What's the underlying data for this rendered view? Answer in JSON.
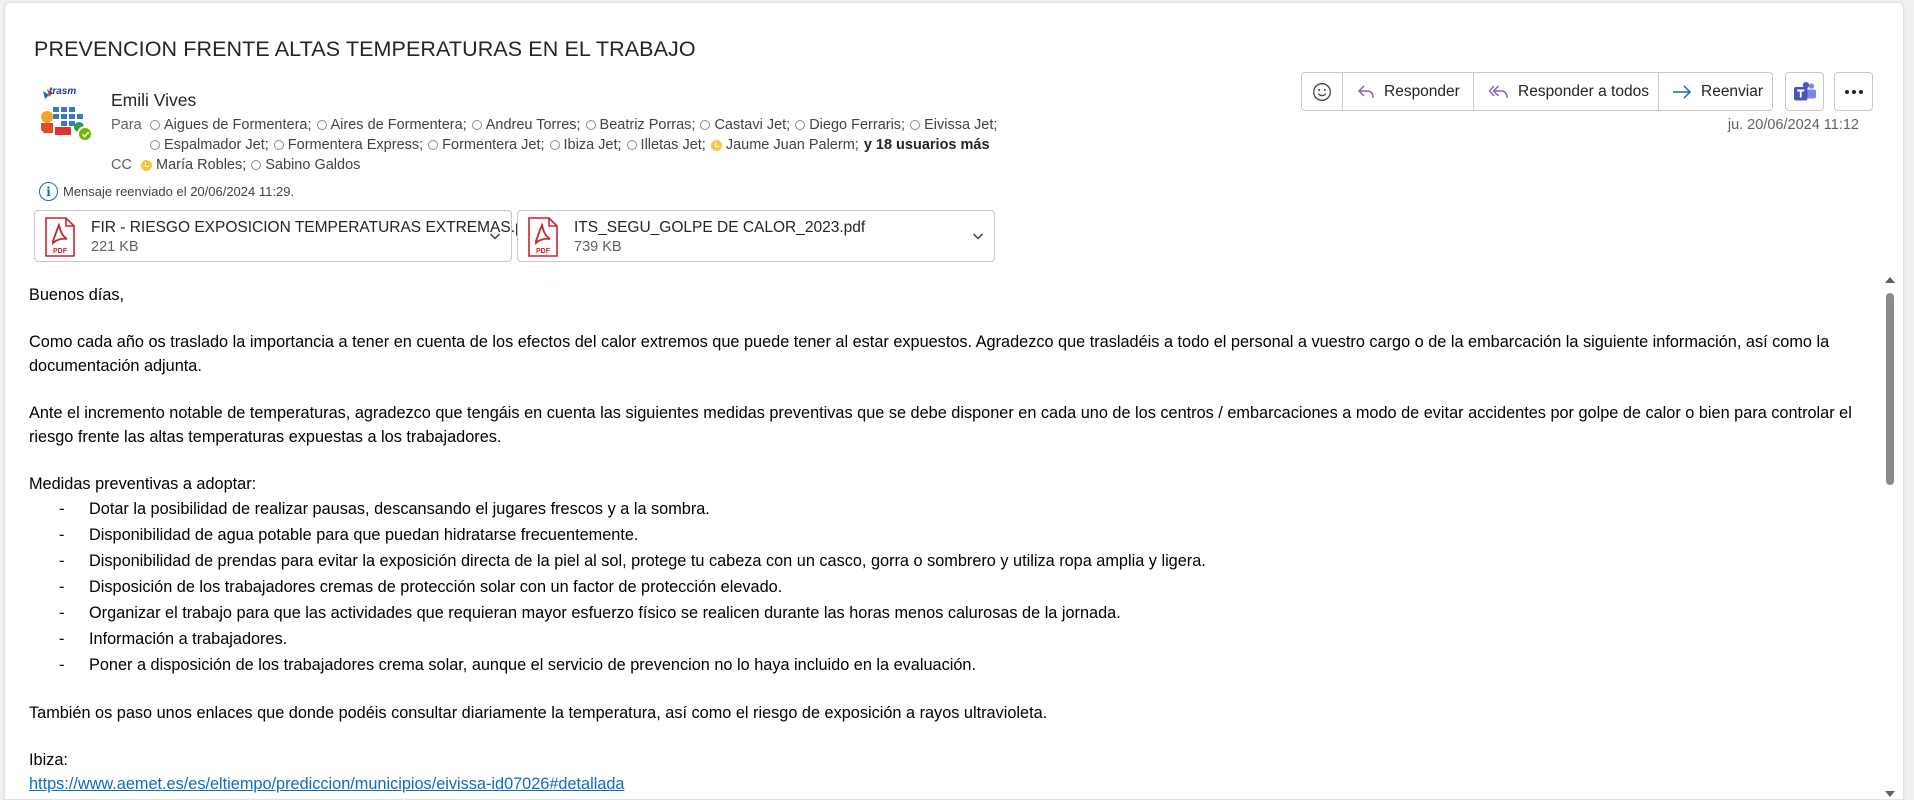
{
  "email": {
    "subject": "PREVENCION FRENTE ALTAS TEMPERATURAS EN EL TRABAJO",
    "sender": "Emili Vives",
    "avatar_logo_text": "trasm",
    "date": "ju. 20/06/2024 11:12",
    "to_label": "Para",
    "to_line1": [
      "Aigues de Formentera;",
      "Aires de Formentera;",
      "Andreu Torres;",
      "Beatriz Porras;",
      "Castavi Jet;",
      "Diego Ferraris;",
      "Eivissa Jet;"
    ],
    "to_line2": [
      {
        "name": "Espalmador Jet;",
        "status": "offline"
      },
      {
        "name": "Formentera Express;",
        "status": "offline"
      },
      {
        "name": "Formentera Jet;",
        "status": "offline"
      },
      {
        "name": "Ibiza Jet;",
        "status": "offline"
      },
      {
        "name": "Illetas Jet;",
        "status": "offline"
      },
      {
        "name": "Jaume Juan Palerm;",
        "status": "away"
      }
    ],
    "more_users": "y 18 usuarios más",
    "cc_label": "CC",
    "cc": [
      {
        "name": "María Robles;",
        "status": "away"
      },
      {
        "name": "Sabino Galdos",
        "status": "offline"
      }
    ],
    "forward_info": "Mensaje reenviado el 20/06/2024 11:29.",
    "attachments": [
      {
        "name": "FIR - RIESGO EXPOSICION TEMPERATURAS EXTREMAS.pdf",
        "size": "221 KB",
        "type_label": "PDF"
      },
      {
        "name": "ITS_SEGU_GOLPE DE CALOR_2023.pdf",
        "size": "739 KB",
        "type_label": "PDF"
      }
    ]
  },
  "toolbar": {
    "reply": "Responder",
    "reply_all": "Responder a todos",
    "forward": "Reenviar"
  },
  "body": {
    "greeting": "Buenos días,",
    "para1": "Como cada año os traslado la importancia a tener en cuenta de los efectos del calor extremos que puede tener al estar expuestos. Agradezco que trasladéis a todo el personal a vuestro cargo o de la embarcación la siguiente información, así como la documentación adjunta.",
    "para2": "Ante el incremento notable de temperaturas, agradezco que tengáis en cuenta las siguientes medidas preventivas que se debe disponer en cada uno de los centros / embarcaciones a modo de evitar accidentes por golpe de calor o bien para controlar el riesgo frente las altas temperaturas expuestas a los trabajadores.",
    "measures_title": "Medidas preventivas a adoptar:",
    "bullet_marker": "-",
    "measures": [
      "Dotar la posibilidad de realizar pausas, descansando el jugares frescos y a la sombra.",
      "Disponibilidad de agua potable para que puedan hidratarse frecuentemente.",
      "Disponibilidad de prendas para evitar la exposición directa de la piel al sol, protege tu cabeza con un casco, gorra o sombrero y utiliza ropa amplia y ligera.",
      "Disposición de los trabajadores cremas de protección solar con un factor de protección elevado.",
      "Organizar el trabajo para que las actividades que requieran mayor esfuerzo físico se realicen durante las horas menos calurosas de la jornada.",
      "Información a trabajadores.",
      "Poner a disposición de los trabajadores crema solar, aunque el servicio de prevencion no lo haya incluido en la evaluación."
    ],
    "para3": "También os paso unos enlaces que donde podéis consultar diariamente la temperatura, así como el riesgo de exposición a rayos ultravioleta.",
    "ibiza_label": "Ibiza:",
    "ibiza_link": "https://www.aemet.es/es/eltiempo/prediccion/municipios/eivissa-id07026#detallada"
  },
  "colors": {
    "accent": "#0f6cbd",
    "pdf_red": "#c4262e",
    "presence_available": "#6bb700",
    "presence_away": "#f8c73e"
  }
}
